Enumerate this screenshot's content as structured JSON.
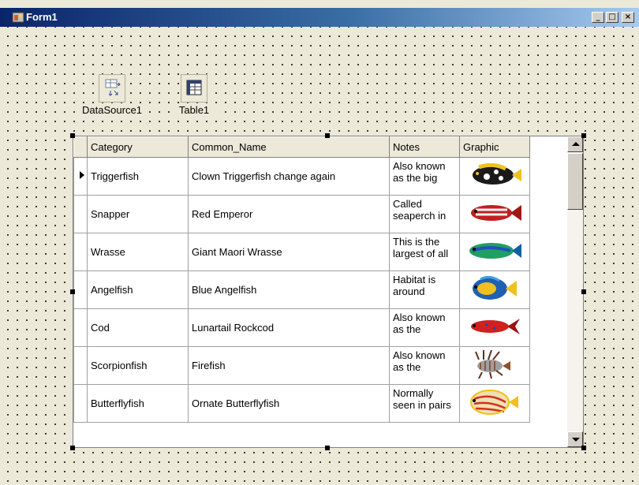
{
  "window": {
    "title": "Form1"
  },
  "components": [
    {
      "label": "DataSource1",
      "icon": "datasource-icon"
    },
    {
      "label": "Table1",
      "icon": "table-icon"
    }
  ],
  "grid": {
    "columns": [
      "Category",
      "Common_Name",
      "Notes",
      "Graphic"
    ],
    "current_row": 0,
    "rows": [
      {
        "category": "Triggerfish",
        "common_name": "Clown Triggerfish change again",
        "notes": "Also known as the big",
        "fish": "triggerfish"
      },
      {
        "category": "Snapper",
        "common_name": "Red Emperor",
        "notes": "Called seaperch in",
        "fish": "snapper"
      },
      {
        "category": "Wrasse",
        "common_name": "Giant Maori Wrasse",
        "notes": "This is the largest of all",
        "fish": "wrasse"
      },
      {
        "category": "Angelfish",
        "common_name": "Blue Angelfish",
        "notes": "Habitat is around",
        "fish": "angelfish"
      },
      {
        "category": "Cod",
        "common_name": "Lunartail Rockcod",
        "notes": "Also known as the",
        "fish": "cod"
      },
      {
        "category": "Scorpionfish",
        "common_name": "Firefish",
        "notes": "Also known as the",
        "fish": "firefish"
      },
      {
        "category": "Butterflyfish",
        "common_name": "Ornate Butterflyfish",
        "notes": "Normally seen in pairs",
        "fish": "butterflyfish"
      }
    ]
  }
}
